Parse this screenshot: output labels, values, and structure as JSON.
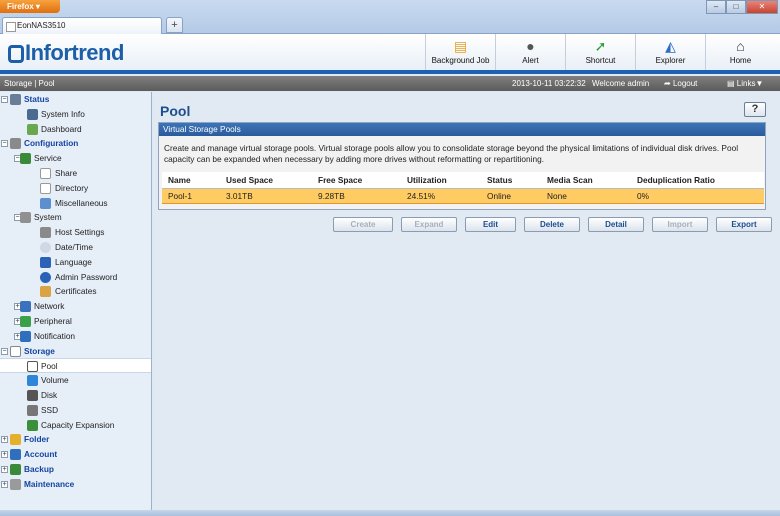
{
  "browser": {
    "menu_button": "Firefox ▾",
    "tab_title": "EonNAS3510",
    "new_tab": "+",
    "window_controls": [
      "–",
      "□",
      "✕"
    ]
  },
  "header": {
    "logo": "Infortrend",
    "buttons": [
      {
        "label": "Background Job",
        "icon": "background-job-icon"
      },
      {
        "label": "Alert",
        "icon": "alert-icon"
      },
      {
        "label": "Shortcut",
        "icon": "shortcut-icon"
      },
      {
        "label": "Explorer",
        "icon": "explorer-icon"
      },
      {
        "label": "Home",
        "icon": "home-icon"
      }
    ]
  },
  "topbar": {
    "breadcrumb": "Storage | Pool",
    "datetime": "2013-10-11 03:22:32",
    "welcome": "Welcome admin",
    "logout": "Logout",
    "links": "Links▼"
  },
  "sidebar": {
    "items": [
      {
        "label": "Status",
        "icon": "status-icon"
      },
      {
        "label": "System Info",
        "icon": "system-info-icon"
      },
      {
        "label": "Dashboard",
        "icon": "dashboard-icon"
      },
      {
        "label": "Configuration",
        "icon": "configuration-icon"
      },
      {
        "label": "Service",
        "icon": "service-icon"
      },
      {
        "label": "Share",
        "icon": "share-icon"
      },
      {
        "label": "Directory",
        "icon": "directory-icon"
      },
      {
        "label": "Miscellaneous",
        "icon": "miscellaneous-icon"
      },
      {
        "label": "System",
        "icon": "system-icon"
      },
      {
        "label": "Host Settings",
        "icon": "host-settings-icon"
      },
      {
        "label": "Date/Time",
        "icon": "clock-icon"
      },
      {
        "label": "Language",
        "icon": "language-icon"
      },
      {
        "label": "Admin Password",
        "icon": "key-icon"
      },
      {
        "label": "Certificates",
        "icon": "certificate-icon"
      },
      {
        "label": "Network",
        "icon": "network-icon"
      },
      {
        "label": "Peripheral",
        "icon": "peripheral-icon"
      },
      {
        "label": "Notification",
        "icon": "notification-icon"
      },
      {
        "label": "Storage",
        "icon": "storage-icon"
      },
      {
        "label": "Pool",
        "icon": "pool-icon"
      },
      {
        "label": "Volume",
        "icon": "volume-icon"
      },
      {
        "label": "Disk",
        "icon": "disk-icon"
      },
      {
        "label": "SSD",
        "icon": "ssd-icon"
      },
      {
        "label": "Capacity Expansion",
        "icon": "capacity-expansion-icon"
      },
      {
        "label": "Folder",
        "icon": "folder-icon"
      },
      {
        "label": "Account",
        "icon": "account-icon"
      },
      {
        "label": "Backup",
        "icon": "backup-icon"
      },
      {
        "label": "Maintenance",
        "icon": "maintenance-icon"
      }
    ]
  },
  "main": {
    "title": "Pool",
    "help": "?",
    "panel_title": "Virtual Storage Pools",
    "description": "Create and manage virtual storage pools. Virtual storage pools allow you to consolidate storage beyond the physical limitations of individual disk drives. Pool capacity can be expanded when necessary by adding more drives without reformatting or repartitioning.",
    "table": {
      "columns": [
        "Name",
        "Used Space",
        "Free Space",
        "Utilization",
        "Status",
        "Media Scan",
        "Deduplication Ratio"
      ],
      "rows": [
        [
          "Pool-1",
          "3.01TB",
          "9.28TB",
          "24.51%",
          "Online",
          "None",
          "0%"
        ]
      ]
    },
    "actions": [
      {
        "label": "Create",
        "enabled": false
      },
      {
        "label": "Expand",
        "enabled": false
      },
      {
        "label": "Edit",
        "enabled": true
      },
      {
        "label": "Delete",
        "enabled": true
      },
      {
        "label": "Detail",
        "enabled": true
      },
      {
        "label": "Import",
        "enabled": false
      },
      {
        "label": "Export",
        "enabled": true
      }
    ]
  },
  "colors": {
    "brand_blue": "#1c5ea8",
    "selected_row": "#ffcb63",
    "panel_header": "#2a5b9c"
  }
}
